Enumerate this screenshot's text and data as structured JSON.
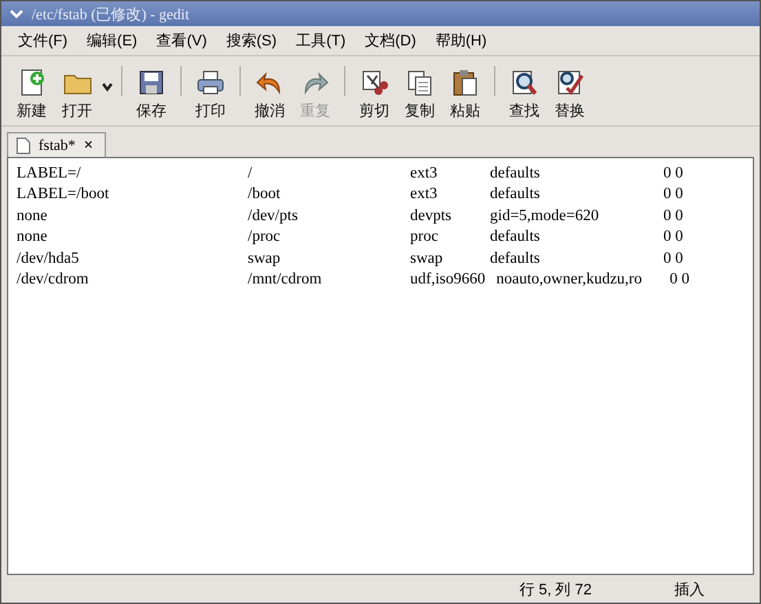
{
  "window": {
    "title": "/etc/fstab (已修改) - gedit"
  },
  "menu": [
    "文件(F)",
    "编辑(E)",
    "查看(V)",
    "搜索(S)",
    "工具(T)",
    "文档(D)",
    "帮助(H)"
  ],
  "toolbar": [
    {
      "kind": "new",
      "label": "新建",
      "disabled": false
    },
    {
      "kind": "open",
      "label": "打开",
      "disabled": false
    },
    {
      "kind": "save",
      "label": "保存",
      "disabled": false
    },
    {
      "kind": "print",
      "label": "打印",
      "disabled": false
    },
    {
      "kind": "undo",
      "label": "撤消",
      "disabled": false
    },
    {
      "kind": "redo",
      "label": "重复",
      "disabled": true
    },
    {
      "kind": "cut",
      "label": "剪切",
      "disabled": false
    },
    {
      "kind": "copy",
      "label": "复制",
      "disabled": false
    },
    {
      "kind": "paste",
      "label": "粘贴",
      "disabled": false
    },
    {
      "kind": "find",
      "label": "查找",
      "disabled": false
    },
    {
      "kind": "replace",
      "label": "替换",
      "disabled": false
    }
  ],
  "tabs": [
    {
      "label": "fstab*",
      "close": "×",
      "selected": true
    }
  ],
  "editor": {
    "lines": [
      [
        "LABEL=/",
        "/",
        "ext3",
        "defaults",
        "0  0"
      ],
      [
        "LABEL=/boot",
        "/boot",
        "ext3",
        "defaults",
        "0  0"
      ],
      [
        "none",
        "/dev/pts",
        "devpts",
        "gid=5,mode=620",
        "0  0"
      ],
      [
        "none",
        "/proc",
        "proc",
        "defaults",
        "0  0"
      ],
      [
        "/dev/hda5",
        "swap",
        "swap",
        "defaults",
        "0  0"
      ],
      [
        "/dev/cdrom",
        "/mnt/cdrom",
        "udf,iso9660",
        "noauto,owner,kudzu,ro",
        "0  0"
      ]
    ]
  },
  "status_bar": {
    "position": "行 5, 列 72",
    "mode": "插入"
  }
}
